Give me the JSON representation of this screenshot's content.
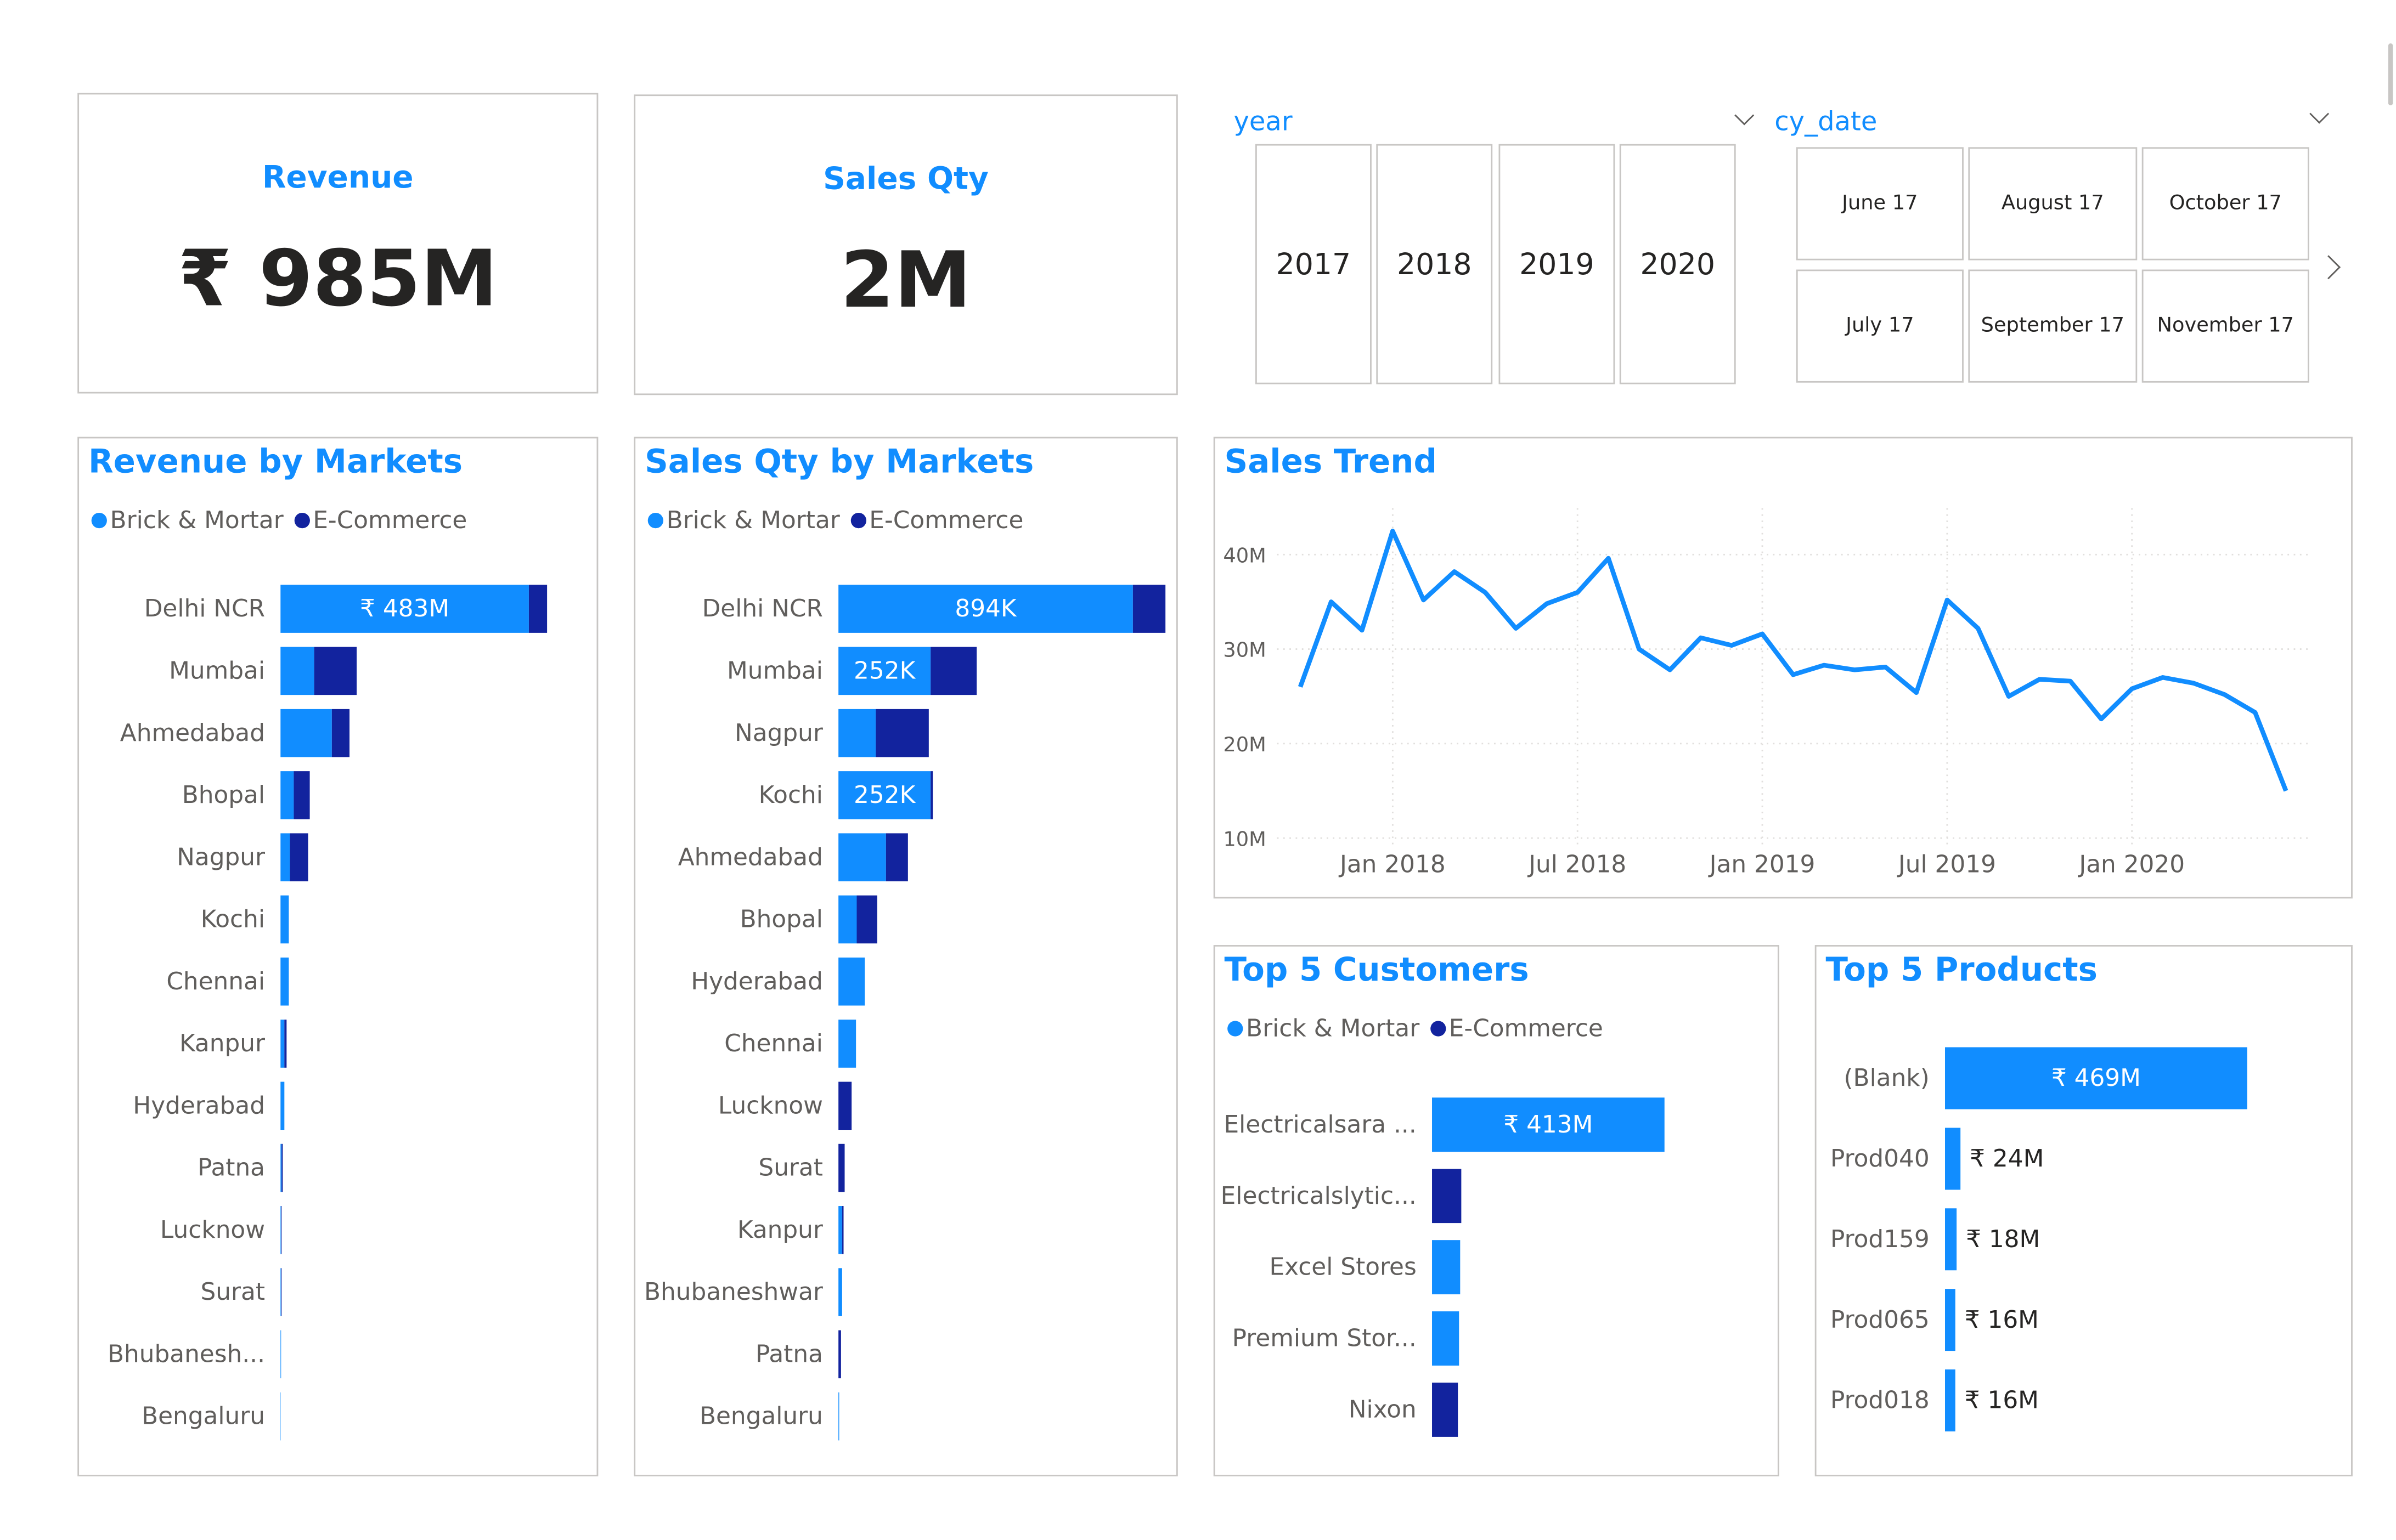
{
  "colors": {
    "brick_mortar": "#118dff",
    "ecommerce": "#12239e",
    "accent": "#118dff",
    "border": "#c8c6c4"
  },
  "kpi": {
    "revenue": {
      "title": "Revenue",
      "value": "₹ 985M"
    },
    "sales_qty": {
      "title": "Sales Qty",
      "value": "2M"
    }
  },
  "slicers": {
    "year": {
      "label": "year",
      "options": [
        "2017",
        "2018",
        "2019",
        "2020"
      ],
      "chevron_icon": "chevron-down-icon"
    },
    "cy_date": {
      "label": "cy_date",
      "options": [
        "June 17",
        "August 17",
        "October 17",
        "July 17",
        "September 17",
        "November 17"
      ],
      "chevron_icon": "chevron-down-icon",
      "next_icon": "chevron-right-icon"
    }
  },
  "legend": {
    "brick_mortar": "Brick & Mortar",
    "ecommerce": "E-Commerce"
  },
  "chart_data": [
    {
      "id": "revenue_by_markets",
      "type": "bar",
      "orientation": "horizontal",
      "stacked": true,
      "title": "Revenue by Markets",
      "legend": "top-left",
      "categories": [
        "Delhi NCR",
        "Mumbai",
        "Ahmedabad",
        "Bhopal",
        "Nagpur",
        "Kochi",
        "Chennai",
        "Kanpur",
        "Hyderabad",
        "Patna",
        "Lucknow",
        "Surat",
        "Bhubanesh...",
        "Bengaluru"
      ],
      "series": [
        {
          "name": "Brick & Mortar",
          "values": [
            450,
            61,
            93,
            24,
            17,
            15,
            15,
            7,
            7,
            2,
            1,
            1,
            1,
            0.5
          ]
        },
        {
          "name": "E-Commerce",
          "values": [
            33,
            77,
            32,
            29,
            33,
            0,
            0,
            4,
            0,
            2,
            1,
            1,
            0,
            0
          ]
        }
      ],
      "data_labels": [
        "₹ 483M",
        "",
        "",
        "",
        "",
        "",
        "",
        "",
        "",
        "",
        "",
        "",
        "",
        ""
      ],
      "xlim": [
        0,
        483
      ]
    },
    {
      "id": "sales_qty_by_markets",
      "type": "bar",
      "orientation": "horizontal",
      "stacked": true,
      "title": "Sales Qty by Markets",
      "legend": "top-left",
      "categories": [
        "Delhi NCR",
        "Mumbai",
        "Nagpur",
        "Kochi",
        "Ahmedabad",
        "Bhopal",
        "Hyderabad",
        "Chennai",
        "Lucknow",
        "Surat",
        "Kanpur",
        "Bhubaneshwar",
        "Patna",
        "Bengaluru"
      ],
      "series": [
        {
          "name": "Brick & Mortar",
          "values": [
            805,
            252,
            102,
            252,
            130,
            50,
            72,
            48,
            0,
            0,
            10,
            10,
            0,
            2
          ]
        },
        {
          "name": "E-Commerce",
          "values": [
            89,
            126,
            145,
            6,
            60,
            56,
            0,
            0,
            36,
            17,
            4,
            0,
            7,
            0
          ]
        }
      ],
      "data_labels": [
        "894K",
        "252K",
        "",
        "252K",
        "",
        "",
        "",
        "",
        "",
        "",
        "",
        "",
        "",
        ""
      ],
      "xlim": [
        0,
        894
      ]
    },
    {
      "id": "sales_trend",
      "type": "line",
      "title": "Sales Trend",
      "y_ticks": [
        "10M",
        "20M",
        "30M",
        "40M"
      ],
      "x_ticks": [
        "Jan 2018",
        "Jul 2018",
        "Jan 2019",
        "Jul 2019",
        "Jan 2020"
      ],
      "ylim": [
        10,
        40
      ],
      "grid": true,
      "x": [
        "2017-10",
        "2017-11",
        "2017-12",
        "2018-01",
        "2018-02",
        "2018-03",
        "2018-04",
        "2018-05",
        "2018-06",
        "2018-07",
        "2018-08",
        "2018-09",
        "2018-10",
        "2018-11",
        "2018-12",
        "2019-01",
        "2019-02",
        "2019-03",
        "2019-04",
        "2019-05",
        "2019-06",
        "2019-07",
        "2019-08",
        "2019-09",
        "2019-10",
        "2019-11",
        "2019-12",
        "2020-01",
        "2020-02",
        "2020-03",
        "2020-04",
        "2020-05",
        "2020-06"
      ],
      "series": [
        {
          "values": [
            26,
            35,
            32,
            42.5,
            35.2,
            38.2,
            36,
            32.2,
            34.8,
            36,
            39.6,
            30,
            27.8,
            31.2,
            30.4,
            31.6,
            27.3,
            28.3,
            27.8,
            28.1,
            25.4,
            35.2,
            32.2,
            25,
            26.8,
            26.6,
            22.6,
            25.8,
            27,
            26.4,
            25.2,
            23.3,
            15
          ]
        }
      ]
    },
    {
      "id": "top5_customers",
      "type": "bar",
      "orientation": "horizontal",
      "stacked": true,
      "title": "Top 5 Customers",
      "legend": "top-left",
      "categories": [
        "Electricalsara ...",
        "Electricalslytic...",
        "Excel Stores",
        "Premium Stor...",
        "Nixon"
      ],
      "series": [
        {
          "name": "Brick & Mortar",
          "values": [
            413,
            0,
            50,
            48,
            0
          ]
        },
        {
          "name": "E-Commerce",
          "values": [
            0,
            52,
            0,
            0,
            46
          ]
        }
      ],
      "data_labels": [
        "₹ 413M",
        "",
        "",
        "",
        ""
      ],
      "xlim": [
        0,
        413
      ]
    },
    {
      "id": "top5_products",
      "type": "bar",
      "orientation": "horizontal",
      "title": "Top 5 Products",
      "categories": [
        "(Blank)",
        "Prod040",
        "Prod159",
        "Prod065",
        "Prod018"
      ],
      "series": [
        {
          "name": "Revenue",
          "values": [
            469,
            24,
            18,
            16,
            16
          ]
        }
      ],
      "data_labels": [
        "₹ 469M",
        "₹ 24M",
        "₹ 18M",
        "₹ 16M",
        "₹ 16M"
      ],
      "xlim": [
        0,
        469
      ]
    }
  ]
}
